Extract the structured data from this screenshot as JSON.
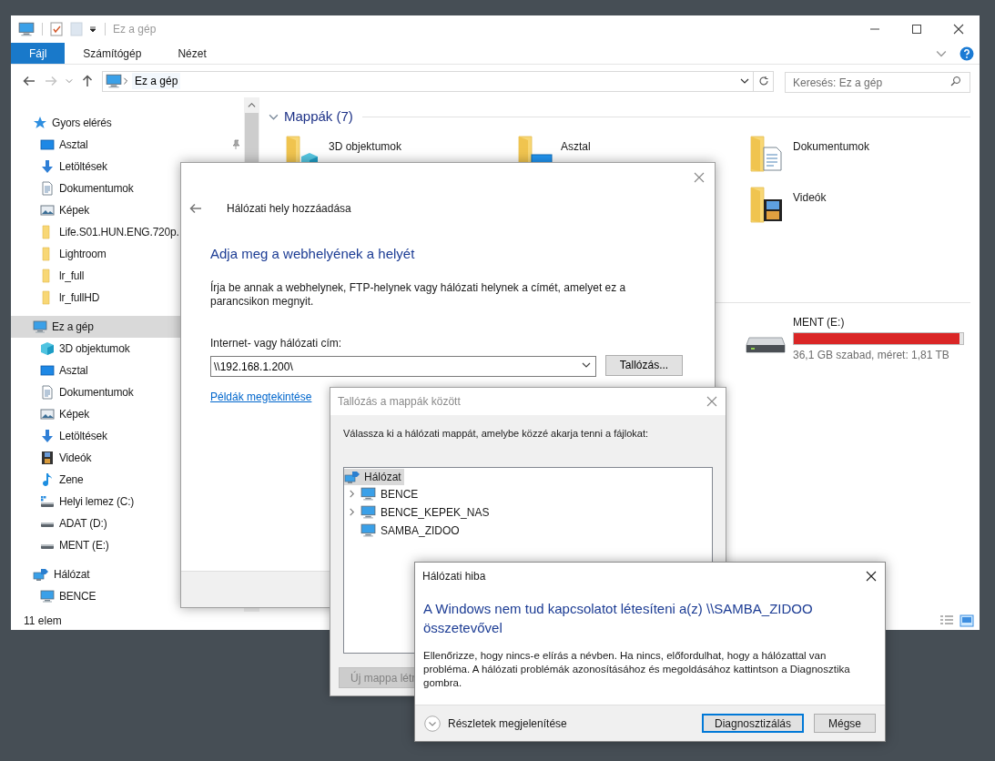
{
  "explorer": {
    "title": "Ez a gép",
    "ribbon_tabs": [
      {
        "label": "Fájl",
        "selected": true
      },
      {
        "label": "Számítógép",
        "selected": false
      },
      {
        "label": "Nézet",
        "selected": false
      }
    ],
    "breadcrumb": "Ez a gép",
    "search": {
      "placeholder": "Keresés: Ez a gép"
    },
    "sidebar": [
      {
        "label": "Gyors elérés",
        "kind": "star",
        "selected": false,
        "children": [
          {
            "label": "Asztal",
            "kind": "desktop",
            "selected": false,
            "pinned": true
          },
          {
            "label": "Letöltések",
            "kind": "download",
            "selected": false
          },
          {
            "label": "Dokumentumok",
            "kind": "document",
            "selected": false
          },
          {
            "label": "Képek",
            "kind": "pictures",
            "selected": false
          },
          {
            "label": "Life.S01.HUN.ENG.720p.",
            "kind": "folder",
            "selected": false
          },
          {
            "label": "Lightroom",
            "kind": "folder",
            "selected": false
          },
          {
            "label": "lr_full",
            "kind": "folder",
            "selected": false
          },
          {
            "label": "lr_fullHD",
            "kind": "folder",
            "selected": false
          }
        ]
      },
      {
        "label": "Ez a gép",
        "kind": "pc",
        "selected": true,
        "children": [
          {
            "label": "3D objektumok",
            "kind": "cube",
            "selected": false
          },
          {
            "label": "Asztal",
            "kind": "desktop",
            "selected": false
          },
          {
            "label": "Dokumentumok",
            "kind": "document",
            "selected": false
          },
          {
            "label": "Képek",
            "kind": "pictures",
            "selected": false
          },
          {
            "label": "Letöltések",
            "kind": "download",
            "selected": false
          },
          {
            "label": "Videók",
            "kind": "video",
            "selected": false
          },
          {
            "label": "Zene",
            "kind": "music",
            "selected": false
          },
          {
            "label": "Helyi lemez (C:)",
            "kind": "drive_c",
            "selected": false
          },
          {
            "label": "ADAT (D:)",
            "kind": "drive",
            "selected": false
          },
          {
            "label": "MENT (E:)",
            "kind": "drive",
            "selected": false
          }
        ]
      },
      {
        "label": "Hálózat",
        "kind": "network",
        "selected": false,
        "children": [
          {
            "label": "BENCE",
            "kind": "pc",
            "selected": false
          }
        ]
      }
    ],
    "folders_section": {
      "title": "Mappák (7)",
      "expanded": true,
      "folders": [
        {
          "name": "3D objektumok",
          "kind": "cube"
        },
        {
          "name": "Asztal",
          "kind": "desktop"
        },
        {
          "name": "Dokumentumok",
          "kind": "document"
        },
        {
          "name": "Videók",
          "kind": "video"
        }
      ]
    },
    "drives": [
      {
        "name": "MENT (E:)",
        "level": 0.98,
        "low_space": true,
        "info": "36,1 GB szabad, méret: 1,81 TB"
      }
    ],
    "status_bar": "11 elem"
  },
  "add_location_dialog": {
    "title": "Hálózati hely hozzáadása",
    "heading": "Adja meg a webhelyének a helyét",
    "description": "Írja be annak a webhelynek, FTP-helynek vagy hálózati helynek a címét, amelyet ez a parancsikon megnyit.",
    "address_label": "Internet- vagy hálózati cím:",
    "address_value": "\\\\192.168.1.200\\",
    "browse_button": "Tallózás...",
    "examples_link": "Példák megtekintése"
  },
  "browse_dialog": {
    "title": "Tallózás a mappák között",
    "active": false,
    "instruction": "Válassza ki a hálózati mappát, amelybe közzé akarja tenni a fájlokat:",
    "tree": [
      {
        "label": "Hálózat",
        "selected": true,
        "children": [
          {
            "label": "BENCE",
            "expandable": true,
            "selected": false
          },
          {
            "label": "BENCE_KEPEK_NAS",
            "expandable": true,
            "selected": false
          },
          {
            "label": "SAMBA_ZIDOO",
            "expandable": false,
            "selected": false
          }
        ]
      }
    ],
    "new_folder_button": {
      "label": "Új mappa létr",
      "disabled": true
    }
  },
  "error_dialog": {
    "title": "Hálózati hiba",
    "heading": "A Windows nem tud kapcsolatot létesíteni a(z) \\\\SAMBA_ZIDOO összetevővel",
    "message": "Ellenőrizze, hogy nincs-e elírás a névben. Ha nincs, előfordulhat, hogy a hálózattal van probléma. A hálózati problémák azonosításához és megoldásához kattintson a Diagnosztika gombra.",
    "details_toggle": "Részletek megjelenítése",
    "buttons": [
      {
        "label": "Diagnosztizálás",
        "default": true
      },
      {
        "label": "Mégse",
        "default": false
      }
    ]
  }
}
